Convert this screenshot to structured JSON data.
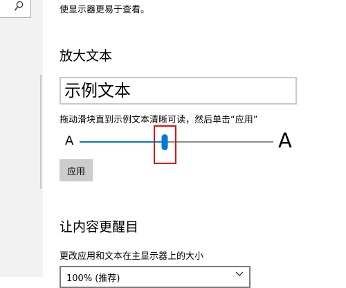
{
  "colors": {
    "accent": "#0078d7",
    "highlight": "#e01010",
    "sidebar_bg": "#f2f2f2",
    "button_bg": "#cccccc"
  },
  "search": {
    "icon": "search-icon"
  },
  "display": {
    "description": "使显示器更易于查看。"
  },
  "text_size": {
    "title": "放大文本",
    "sample_text": "示例文本",
    "instruction": "拖动滑块直到示例文本清晰可读，然后单击“应用”",
    "small_label": "A",
    "large_label": "A",
    "slider_level_fraction": 0.44,
    "apply_label": "应用"
  },
  "make_bigger": {
    "title": "让内容更醒目",
    "scale_label": "更改应用和文本在主显示器上的大小",
    "scale_value": "100% (推荐)",
    "dropdown_icon": "chevron-down-icon"
  }
}
